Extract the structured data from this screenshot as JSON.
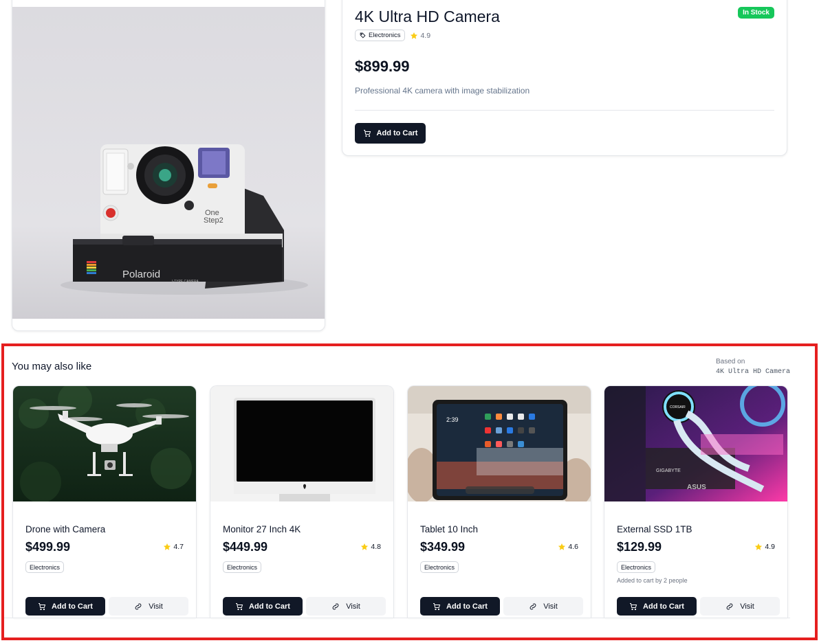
{
  "product": {
    "title": "4K Ultra HD Camera",
    "stock": "In Stock",
    "category": "Electronics",
    "rating": "4.9",
    "price": "$899.99",
    "description": "Professional 4K camera with image stabilization",
    "add_to_cart": "Add to Cart",
    "image_text": "Polaroid",
    "image_small_text": "I-TYPE CAMERA",
    "image_model_text_1": "One",
    "image_model_text_2": "Step2"
  },
  "recommendations": {
    "title": "You may also like",
    "based_on_label": "Based on",
    "based_on_product": "4K Ultra HD Camera",
    "items": [
      {
        "name": "Drone with Camera",
        "price": "$499.99",
        "rating": "4.7",
        "category": "Electronics",
        "note": "",
        "add_label": "Add to Cart",
        "visit_label": "Visit"
      },
      {
        "name": "Monitor 27 Inch 4K",
        "price": "$449.99",
        "rating": "4.8",
        "category": "Electronics",
        "note": "",
        "add_label": "Add to Cart",
        "visit_label": "Visit"
      },
      {
        "name": "Tablet 10 Inch",
        "price": "$349.99",
        "rating": "4.6",
        "category": "Electronics",
        "note": "",
        "add_label": "Add to Cart",
        "visit_label": "Visit"
      },
      {
        "name": "External SSD 1TB",
        "price": "$129.99",
        "rating": "4.9",
        "category": "Electronics",
        "note": "Added to cart by 2 people",
        "add_label": "Add to Cart",
        "visit_label": "Visit"
      }
    ],
    "image_texts": {
      "tablet_time": "2:39",
      "pc_brand_1": "CORSAIR",
      "pc_brand_2": "GIGABYTE",
      "pc_brand_3": "ASUS"
    }
  },
  "colors": {
    "stock_green": "#16c75a",
    "button_dark": "#111827",
    "star_yellow": "#facc15",
    "highlight_border": "#e51f1f"
  },
  "icons": [
    "tag-icon",
    "star-icon",
    "cart-icon",
    "link-icon"
  ]
}
